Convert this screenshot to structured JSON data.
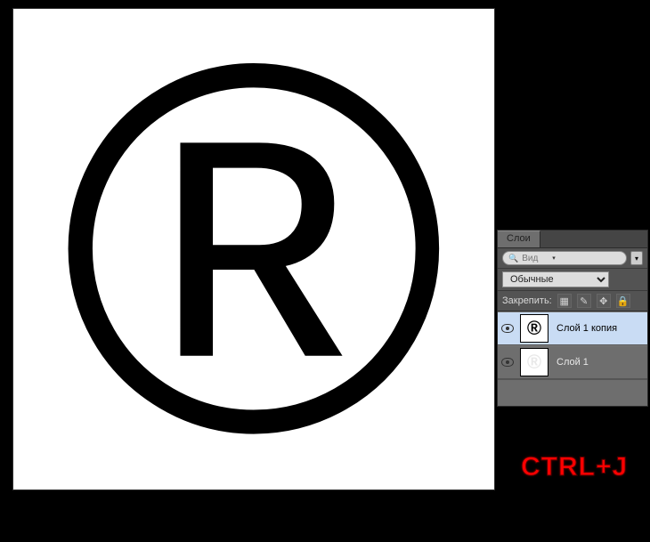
{
  "panel": {
    "tab_label": "Слои",
    "search": {
      "placeholder": "Вид",
      "icon": "search-icon"
    },
    "blend_mode": "Обычные",
    "lock_label": "Закрепить:",
    "lock_icons": {
      "pixels": "▦",
      "brush": "✎",
      "move": "✥",
      "all": "🔒"
    },
    "layers": [
      {
        "name": "Слой 1 копия",
        "selected": true,
        "visible": true
      },
      {
        "name": "Слой 1",
        "selected": false,
        "visible": true
      }
    ]
  },
  "canvas": {
    "symbol": "®"
  },
  "shortcut": "CTRL+J"
}
